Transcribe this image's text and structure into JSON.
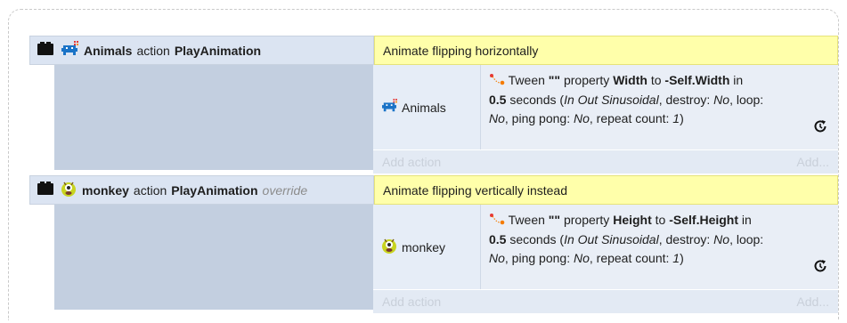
{
  "events": [
    {
      "object": "Animals",
      "action_word": "action",
      "behavior": "PlayAnimation",
      "override": "",
      "comment": "Animate flipping horizontally",
      "action_object": "Animals",
      "tween_prefix": "Tween",
      "tween_quotes": "\"\"",
      "property_word": "property",
      "property": "Width",
      "to_word": "to",
      "target": "-Self.Width",
      "in_word": "in",
      "duration": "0.5",
      "seconds_open": "seconds (",
      "easing": "In Out Sinusoidal",
      "destroy_label": ", destroy: ",
      "destroy_val": "No",
      "loop_label": ", loop:",
      "loop_val": "No",
      "pingpong_label": ", ping pong: ",
      "pingpong_val": "No",
      "repeat_label": ", repeat count: ",
      "repeat_val": "1",
      "close": ")",
      "add_action": "Add action",
      "add_more": "Add..."
    },
    {
      "object": "monkey",
      "action_word": "action",
      "behavior": "PlayAnimation",
      "override": "override",
      "comment": "Animate flipping vertically instead",
      "action_object": "monkey",
      "tween_prefix": "Tween",
      "tween_quotes": "\"\"",
      "property_word": "property",
      "property": "Height",
      "to_word": "to",
      "target": "-Self.Height",
      "in_word": "in",
      "duration": "0.5",
      "seconds_open": "seconds (",
      "easing": "In Out Sinusoidal",
      "destroy_label": ", destroy: ",
      "destroy_val": "No",
      "loop_label": ", loop:",
      "loop_val": "No",
      "pingpong_label": ", ping pong: ",
      "pingpong_val": "No",
      "repeat_label": ", repeat count: ",
      "repeat_val": "1",
      "close": ")",
      "add_action": "Add action",
      "add_more": "Add..."
    }
  ],
  "icons": [
    "function-icon",
    "space-invader-icon",
    "monkey-icon",
    "tween-icon",
    "async-repeat-icon"
  ],
  "colors": {
    "header_bg": "#dbe4f2",
    "comment_bg": "#ffffaa",
    "side_bg": "#c3cfe0",
    "action_bg": "#e9eef6"
  }
}
